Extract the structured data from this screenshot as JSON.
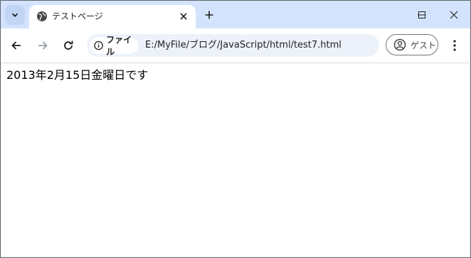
{
  "browser": {
    "tab": {
      "title": "テストページ"
    },
    "omnibox": {
      "chip_label": "ファイル",
      "url": "E:/MyFile/ブログ/JavaScript/html/test7.html"
    },
    "profile": {
      "label": "ゲスト"
    }
  },
  "page": {
    "text": "2013年2月15日金曜日です"
  },
  "icons": {
    "tab_search": "chevron-down-icon",
    "favicon": "globe-icon",
    "tab_close": "close-icon",
    "new_tab": "plus-icon",
    "minimize": "minimize-icon",
    "maximize": "maximize-icon",
    "window_close": "close-icon",
    "back": "arrow-left-icon",
    "forward": "arrow-right-icon",
    "reload": "reload-icon",
    "info": "info-icon",
    "profile": "person-circle-icon",
    "menu": "kebab-menu-icon"
  },
  "colors": {
    "tabstrip_bg": "#d3e3fd",
    "omnibox_bg": "#edf2fa",
    "text": "#1f1f1f"
  }
}
